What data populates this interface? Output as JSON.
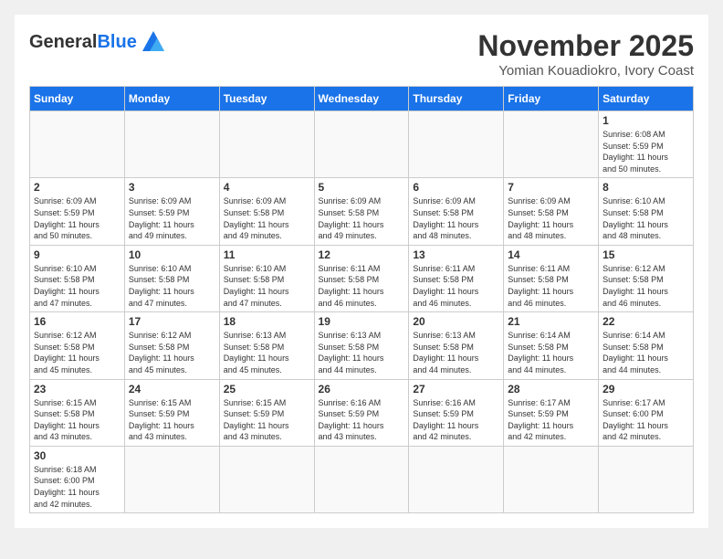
{
  "header": {
    "logo": "GeneralBlue",
    "title": "November 2025",
    "location": "Yomian Kouadiokro, Ivory Coast"
  },
  "days_of_week": [
    "Sunday",
    "Monday",
    "Tuesday",
    "Wednesday",
    "Thursday",
    "Friday",
    "Saturday"
  ],
  "weeks": [
    [
      {
        "day": "",
        "info": ""
      },
      {
        "day": "",
        "info": ""
      },
      {
        "day": "",
        "info": ""
      },
      {
        "day": "",
        "info": ""
      },
      {
        "day": "",
        "info": ""
      },
      {
        "day": "",
        "info": ""
      },
      {
        "day": "1",
        "info": "Sunrise: 6:08 AM\nSunset: 5:59 PM\nDaylight: 11 hours\nand 50 minutes."
      }
    ],
    [
      {
        "day": "2",
        "info": "Sunrise: 6:09 AM\nSunset: 5:59 PM\nDaylight: 11 hours\nand 50 minutes."
      },
      {
        "day": "3",
        "info": "Sunrise: 6:09 AM\nSunset: 5:59 PM\nDaylight: 11 hours\nand 49 minutes."
      },
      {
        "day": "4",
        "info": "Sunrise: 6:09 AM\nSunset: 5:58 PM\nDaylight: 11 hours\nand 49 minutes."
      },
      {
        "day": "5",
        "info": "Sunrise: 6:09 AM\nSunset: 5:58 PM\nDaylight: 11 hours\nand 49 minutes."
      },
      {
        "day": "6",
        "info": "Sunrise: 6:09 AM\nSunset: 5:58 PM\nDaylight: 11 hours\nand 48 minutes."
      },
      {
        "day": "7",
        "info": "Sunrise: 6:09 AM\nSunset: 5:58 PM\nDaylight: 11 hours\nand 48 minutes."
      },
      {
        "day": "8",
        "info": "Sunrise: 6:10 AM\nSunset: 5:58 PM\nDaylight: 11 hours\nand 48 minutes."
      }
    ],
    [
      {
        "day": "9",
        "info": "Sunrise: 6:10 AM\nSunset: 5:58 PM\nDaylight: 11 hours\nand 47 minutes."
      },
      {
        "day": "10",
        "info": "Sunrise: 6:10 AM\nSunset: 5:58 PM\nDaylight: 11 hours\nand 47 minutes."
      },
      {
        "day": "11",
        "info": "Sunrise: 6:10 AM\nSunset: 5:58 PM\nDaylight: 11 hours\nand 47 minutes."
      },
      {
        "day": "12",
        "info": "Sunrise: 6:11 AM\nSunset: 5:58 PM\nDaylight: 11 hours\nand 46 minutes."
      },
      {
        "day": "13",
        "info": "Sunrise: 6:11 AM\nSunset: 5:58 PM\nDaylight: 11 hours\nand 46 minutes."
      },
      {
        "day": "14",
        "info": "Sunrise: 6:11 AM\nSunset: 5:58 PM\nDaylight: 11 hours\nand 46 minutes."
      },
      {
        "day": "15",
        "info": "Sunrise: 6:12 AM\nSunset: 5:58 PM\nDaylight: 11 hours\nand 46 minutes."
      }
    ],
    [
      {
        "day": "16",
        "info": "Sunrise: 6:12 AM\nSunset: 5:58 PM\nDaylight: 11 hours\nand 45 minutes."
      },
      {
        "day": "17",
        "info": "Sunrise: 6:12 AM\nSunset: 5:58 PM\nDaylight: 11 hours\nand 45 minutes."
      },
      {
        "day": "18",
        "info": "Sunrise: 6:13 AM\nSunset: 5:58 PM\nDaylight: 11 hours\nand 45 minutes."
      },
      {
        "day": "19",
        "info": "Sunrise: 6:13 AM\nSunset: 5:58 PM\nDaylight: 11 hours\nand 44 minutes."
      },
      {
        "day": "20",
        "info": "Sunrise: 6:13 AM\nSunset: 5:58 PM\nDaylight: 11 hours\nand 44 minutes."
      },
      {
        "day": "21",
        "info": "Sunrise: 6:14 AM\nSunset: 5:58 PM\nDaylight: 11 hours\nand 44 minutes."
      },
      {
        "day": "22",
        "info": "Sunrise: 6:14 AM\nSunset: 5:58 PM\nDaylight: 11 hours\nand 44 minutes."
      }
    ],
    [
      {
        "day": "23",
        "info": "Sunrise: 6:15 AM\nSunset: 5:58 PM\nDaylight: 11 hours\nand 43 minutes."
      },
      {
        "day": "24",
        "info": "Sunrise: 6:15 AM\nSunset: 5:59 PM\nDaylight: 11 hours\nand 43 minutes."
      },
      {
        "day": "25",
        "info": "Sunrise: 6:15 AM\nSunset: 5:59 PM\nDaylight: 11 hours\nand 43 minutes."
      },
      {
        "day": "26",
        "info": "Sunrise: 6:16 AM\nSunset: 5:59 PM\nDaylight: 11 hours\nand 43 minutes."
      },
      {
        "day": "27",
        "info": "Sunrise: 6:16 AM\nSunset: 5:59 PM\nDaylight: 11 hours\nand 42 minutes."
      },
      {
        "day": "28",
        "info": "Sunrise: 6:17 AM\nSunset: 5:59 PM\nDaylight: 11 hours\nand 42 minutes."
      },
      {
        "day": "29",
        "info": "Sunrise: 6:17 AM\nSunset: 6:00 PM\nDaylight: 11 hours\nand 42 minutes."
      }
    ],
    [
      {
        "day": "30",
        "info": "Sunrise: 6:18 AM\nSunset: 6:00 PM\nDaylight: 11 hours\nand 42 minutes."
      },
      {
        "day": "",
        "info": ""
      },
      {
        "day": "",
        "info": ""
      },
      {
        "day": "",
        "info": ""
      },
      {
        "day": "",
        "info": ""
      },
      {
        "day": "",
        "info": ""
      },
      {
        "day": "",
        "info": ""
      }
    ]
  ]
}
